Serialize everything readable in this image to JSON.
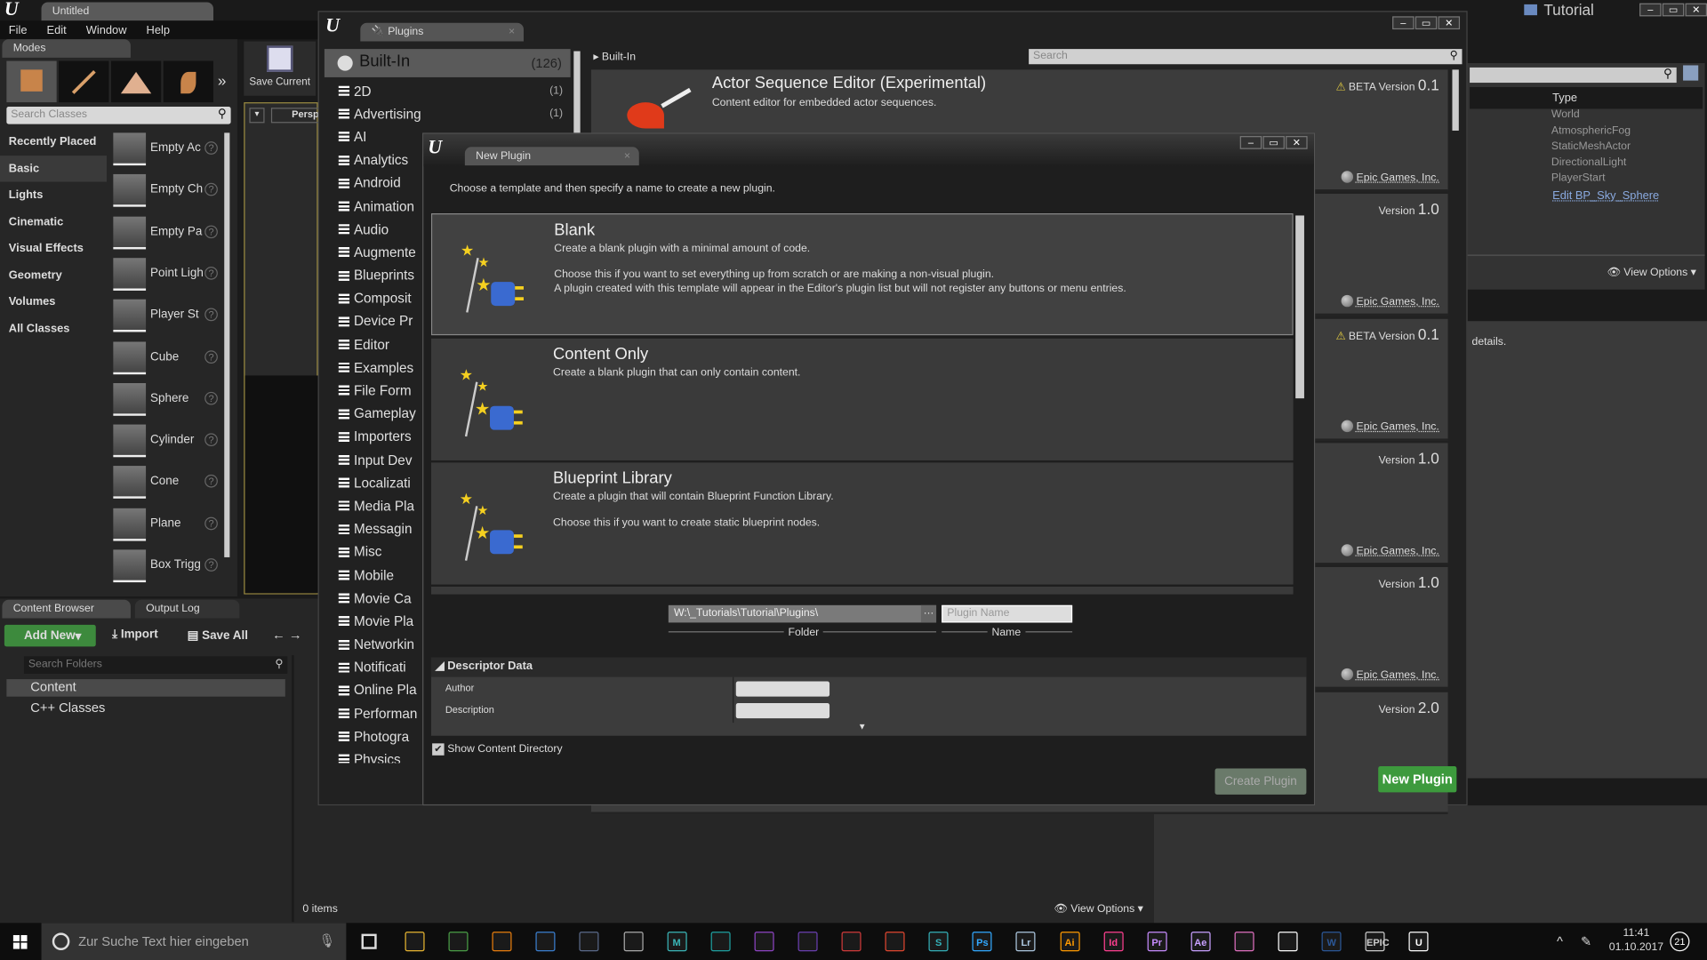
{
  "editor": {
    "tab_title": "Untitled",
    "menu": [
      "File",
      "Edit",
      "Window",
      "Help"
    ],
    "tutorial_label": "Tutorial"
  },
  "modes": {
    "tab": "Modes",
    "search_placeholder": "Search Classes",
    "save_current": "Save Current",
    "viewport_label": "Persp",
    "categories": [
      "Recently Placed",
      "Basic",
      "Lights",
      "Cinematic",
      "Visual Effects",
      "Geometry",
      "Volumes",
      "All Classes"
    ],
    "selected_category": "Basic",
    "items": [
      "Empty Ac",
      "Empty Ch",
      "Empty Pa",
      "Point Ligh",
      "Player St",
      "Cube",
      "Sphere",
      "Cylinder",
      "Cone",
      "Plane",
      "Box Trigg"
    ]
  },
  "content_browser": {
    "tabs": [
      "Content Browser",
      "Output Log"
    ],
    "add_new": "Add New",
    "import": "Import",
    "save_all": "Save All",
    "search_placeholder": "Search Folders",
    "folders": [
      "Content",
      "C++ Classes"
    ],
    "items_count": "0 items",
    "view_options": "View Options"
  },
  "outliner": {
    "type_header": "Type",
    "types": [
      "World",
      "AtmosphericFog",
      "StaticMeshActor",
      "DirectionalLight",
      "PlayerStart"
    ],
    "link": "Edit BP_Sky_Sphere",
    "view_options": "View Options",
    "details_hint": "details."
  },
  "plugins": {
    "tab": "Plugins",
    "root": {
      "label": "Built-In",
      "count": "(126)"
    },
    "categories": [
      {
        "label": "2D",
        "count": "(1)"
      },
      {
        "label": "Advertising",
        "count": "(1)"
      },
      {
        "label": "AI"
      },
      {
        "label": "Analytics"
      },
      {
        "label": "Android"
      },
      {
        "label": "Animation"
      },
      {
        "label": "Audio"
      },
      {
        "label": "Augmente"
      },
      {
        "label": "Blueprints"
      },
      {
        "label": "Composit"
      },
      {
        "label": "Device Pr"
      },
      {
        "label": "Editor"
      },
      {
        "label": "Examples"
      },
      {
        "label": "File Form"
      },
      {
        "label": "Gameplay"
      },
      {
        "label": "Importers"
      },
      {
        "label": "Input Dev"
      },
      {
        "label": "Localizati"
      },
      {
        "label": "Media Pla"
      },
      {
        "label": "Messagin"
      },
      {
        "label": "Misc"
      },
      {
        "label": "Mobile"
      },
      {
        "label": "Movie Ca"
      },
      {
        "label": "Movie Pla"
      },
      {
        "label": "Networkin"
      },
      {
        "label": "Notificati"
      },
      {
        "label": "Online Pla"
      },
      {
        "label": "Performan"
      },
      {
        "label": "Photogra"
      },
      {
        "label": "Physics"
      }
    ],
    "breadcrumb": "Built-In",
    "search_placeholder": "Search",
    "first_plugin": {
      "title": "Actor Sequence Editor (Experimental)",
      "description": "Content editor for embedded actor sequences."
    },
    "cards": [
      {
        "version_prefix": "BETA Version",
        "version": "0.1",
        "beta": true,
        "vendor": "Epic Games, Inc."
      },
      {
        "version_prefix": "Version",
        "version": "1.0",
        "vendor": "Epic Games, Inc."
      },
      {
        "version_prefix": "BETA Version",
        "version": "0.1",
        "beta": true,
        "vendor": "Epic Games, Inc."
      },
      {
        "version_prefix": "Version",
        "version": "1.0",
        "vendor": "Epic Games, Inc."
      },
      {
        "version_prefix": "Version",
        "version": "1.0",
        "vendor": "Epic Games, Inc."
      },
      {
        "version_prefix": "Version",
        "version": "2.0"
      }
    ],
    "new_plugin_button": "New Plugin"
  },
  "new_plugin": {
    "tab": "New Plugin",
    "instructions": "Choose a template and then specify a name to create a new plugin.",
    "templates": [
      {
        "title": "Blank",
        "lines": [
          "Create a blank plugin with a minimal amount of code.",
          "Choose this if you want to set everything up from scratch or are making a non-visual plugin.",
          "A plugin created with this template will appear in the Editor's plugin list but will not register any buttons or menu entries."
        ]
      },
      {
        "title": "Content Only",
        "lines": [
          "Create a blank plugin that can only contain content."
        ]
      },
      {
        "title": "Blueprint Library",
        "lines": [
          "Create a plugin that will contain Blueprint Function Library.",
          "Choose this if you want to create static blueprint nodes."
        ]
      }
    ],
    "selected_template": "Blank",
    "folder_value": "W:\\_Tutorials\\Tutorial\\Plugins\\",
    "folder_label": "Folder",
    "name_placeholder": "Plugin Name",
    "name_label": "Name",
    "descriptor": {
      "header": "Descriptor Data",
      "fields": [
        {
          "label": "Author",
          "value": ""
        },
        {
          "label": "Description",
          "value": ""
        }
      ]
    },
    "show_content_directory": {
      "label": "Show Content Directory",
      "checked": true
    },
    "create_button": "Create Plugin"
  },
  "taskbar": {
    "search_placeholder": "Zur Suche Text hier eingeben",
    "time": "11:41",
    "date": "01.10.2017",
    "notifications": "21",
    "apps": [
      {
        "icon": "file-explorer-icon",
        "label": "",
        "color": "#e8b531"
      },
      {
        "icon": "chrome-icon",
        "label": "",
        "color": "#4a9e46"
      },
      {
        "icon": "blender-icon",
        "label": "",
        "color": "#e87d0d"
      },
      {
        "icon": "substance-icon",
        "label": "",
        "color": "#3a7fd0"
      },
      {
        "icon": "film-icon",
        "label": "",
        "color": "#5a6a8a"
      },
      {
        "icon": "zbrush-icon",
        "label": "",
        "color": "#aaaaaa"
      },
      {
        "icon": "maya-icon",
        "label": "M",
        "color": "#3ab6b8"
      },
      {
        "icon": "max-icon",
        "label": "",
        "color": "#1ea0a0"
      },
      {
        "icon": "visual-studio-icon",
        "label": "",
        "color": "#8e44c4"
      },
      {
        "icon": "vs-code-icon",
        "label": "",
        "color": "#6a3fb0"
      },
      {
        "icon": "git-icon",
        "label": "",
        "color": "#d03a3a"
      },
      {
        "icon": "substance-painter-icon",
        "label": "",
        "color": "#e0462f"
      },
      {
        "icon": "substance-s-icon",
        "label": "S",
        "color": "#34b0b8"
      },
      {
        "icon": "photoshop-icon",
        "label": "Ps",
        "color": "#31a8ff"
      },
      {
        "icon": "lightroom-icon",
        "label": "Lr",
        "color": "#adc8e0"
      },
      {
        "icon": "illustrator-icon",
        "label": "Ai",
        "color": "#ff9a00"
      },
      {
        "icon": "indesign-icon",
        "label": "Id",
        "color": "#ff3f90"
      },
      {
        "icon": "premiere-icon",
        "label": "Pr",
        "color": "#c78cff"
      },
      {
        "icon": "after-effects-icon",
        "label": "Ae",
        "color": "#c8a0ff"
      },
      {
        "icon": "krita-icon",
        "label": "",
        "color": "#e070c0"
      },
      {
        "icon": "photos-icon",
        "label": "",
        "color": "#ffffff"
      },
      {
        "icon": "word-icon",
        "label": "W",
        "color": "#2b5797"
      },
      {
        "icon": "epic-games-icon",
        "label": "EPIC",
        "color": "#cccccc"
      },
      {
        "icon": "unreal-icon",
        "label": "U",
        "color": "#ffffff"
      }
    ]
  }
}
